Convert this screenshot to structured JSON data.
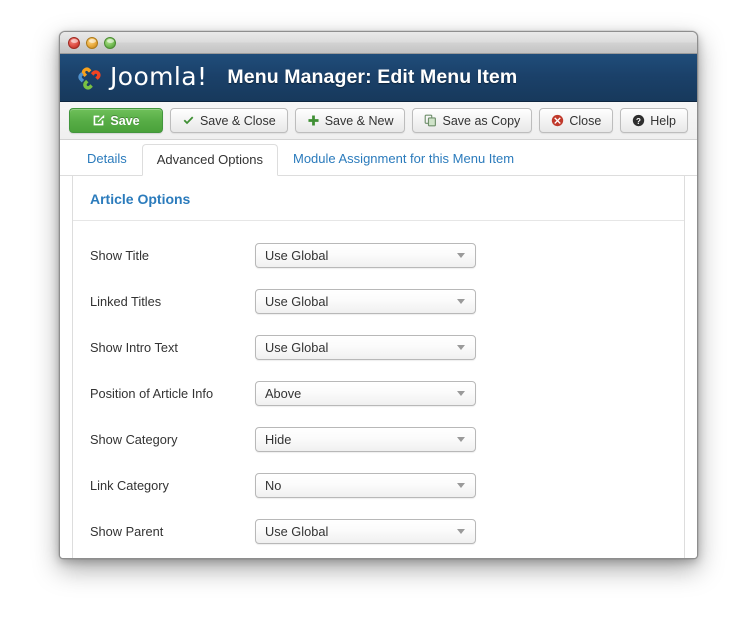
{
  "window": {
    "traffic_lights": [
      "close",
      "minimize",
      "zoom"
    ]
  },
  "header": {
    "brand": "Joomla!",
    "title": "Menu Manager: Edit Menu Item"
  },
  "toolbar": {
    "buttons": [
      {
        "label": "Save",
        "icon": "save-icon",
        "style": "primary"
      },
      {
        "label": "Save & Close",
        "icon": "check-icon",
        "style": "default"
      },
      {
        "label": "Save & New",
        "icon": "plus-icon",
        "style": "default"
      },
      {
        "label": "Save as Copy",
        "icon": "copy-icon",
        "style": "default"
      },
      {
        "label": "Close",
        "icon": "close-circle-icon",
        "style": "default"
      },
      {
        "label": "Help",
        "icon": "help-circle-icon",
        "style": "default"
      }
    ]
  },
  "tabs": [
    {
      "label": "Details",
      "active": false
    },
    {
      "label": "Advanced Options",
      "active": true
    },
    {
      "label": "Module Assignment for this Menu Item",
      "active": false
    }
  ],
  "content": {
    "section_title": "Article Options",
    "fields": [
      {
        "label": "Show Title",
        "value": "Use Global"
      },
      {
        "label": "Linked Titles",
        "value": "Use Global"
      },
      {
        "label": "Show Intro Text",
        "value": "Use Global"
      },
      {
        "label": "Position of Article Info",
        "value": "Above"
      },
      {
        "label": "Show Category",
        "value": "Hide"
      },
      {
        "label": "Link Category",
        "value": "No"
      },
      {
        "label": "Show Parent",
        "value": "Use Global"
      }
    ]
  },
  "colors": {
    "header_blue": "#1b416a",
    "accent_blue": "#2b7bbc",
    "save_green": "#57ad46",
    "close_red": "#c0392b"
  }
}
